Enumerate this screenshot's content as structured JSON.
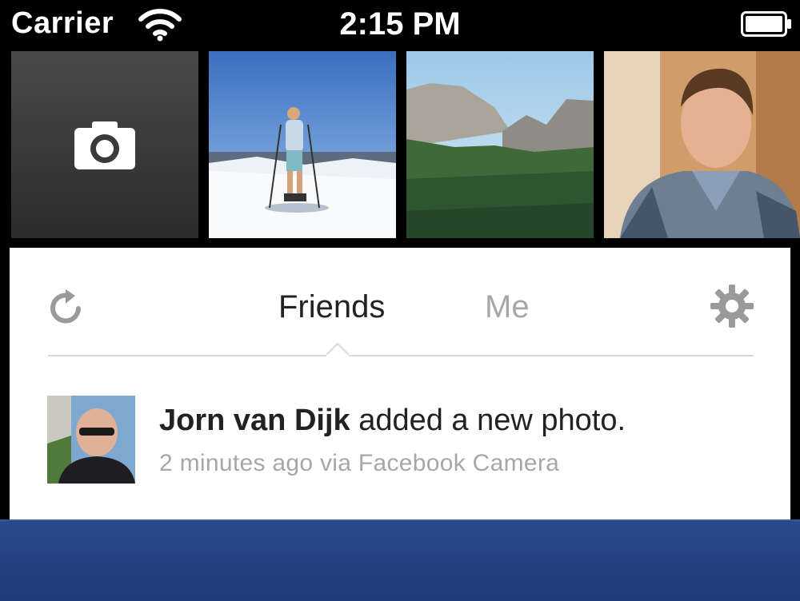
{
  "status_bar": {
    "carrier": "Carrier",
    "time": "2:15 PM",
    "icons": [
      "wifi-icon",
      "battery-icon"
    ]
  },
  "photo_strip": {
    "camera_icon": "camera-icon",
    "thumbnails": [
      "skier-on-snow-photo",
      "mountain-valley-photo",
      "smiling-man-photo"
    ]
  },
  "feed": {
    "tabs": [
      {
        "label": "Friends",
        "active": true
      },
      {
        "label": "Me",
        "active": false
      }
    ],
    "refresh_icon": "refresh-icon",
    "settings_icon": "gear-icon",
    "items": [
      {
        "name": "Jorn van Dijk",
        "action": "added a new photo.",
        "meta": "2 minutes ago via Facebook Camera"
      }
    ]
  },
  "colors": {
    "status_bg": "#000000",
    "card_bg": "#ffffff",
    "active_tab": "#222222",
    "inactive_tab": "#a7a7a7",
    "bottom_bar": "#23407f"
  }
}
